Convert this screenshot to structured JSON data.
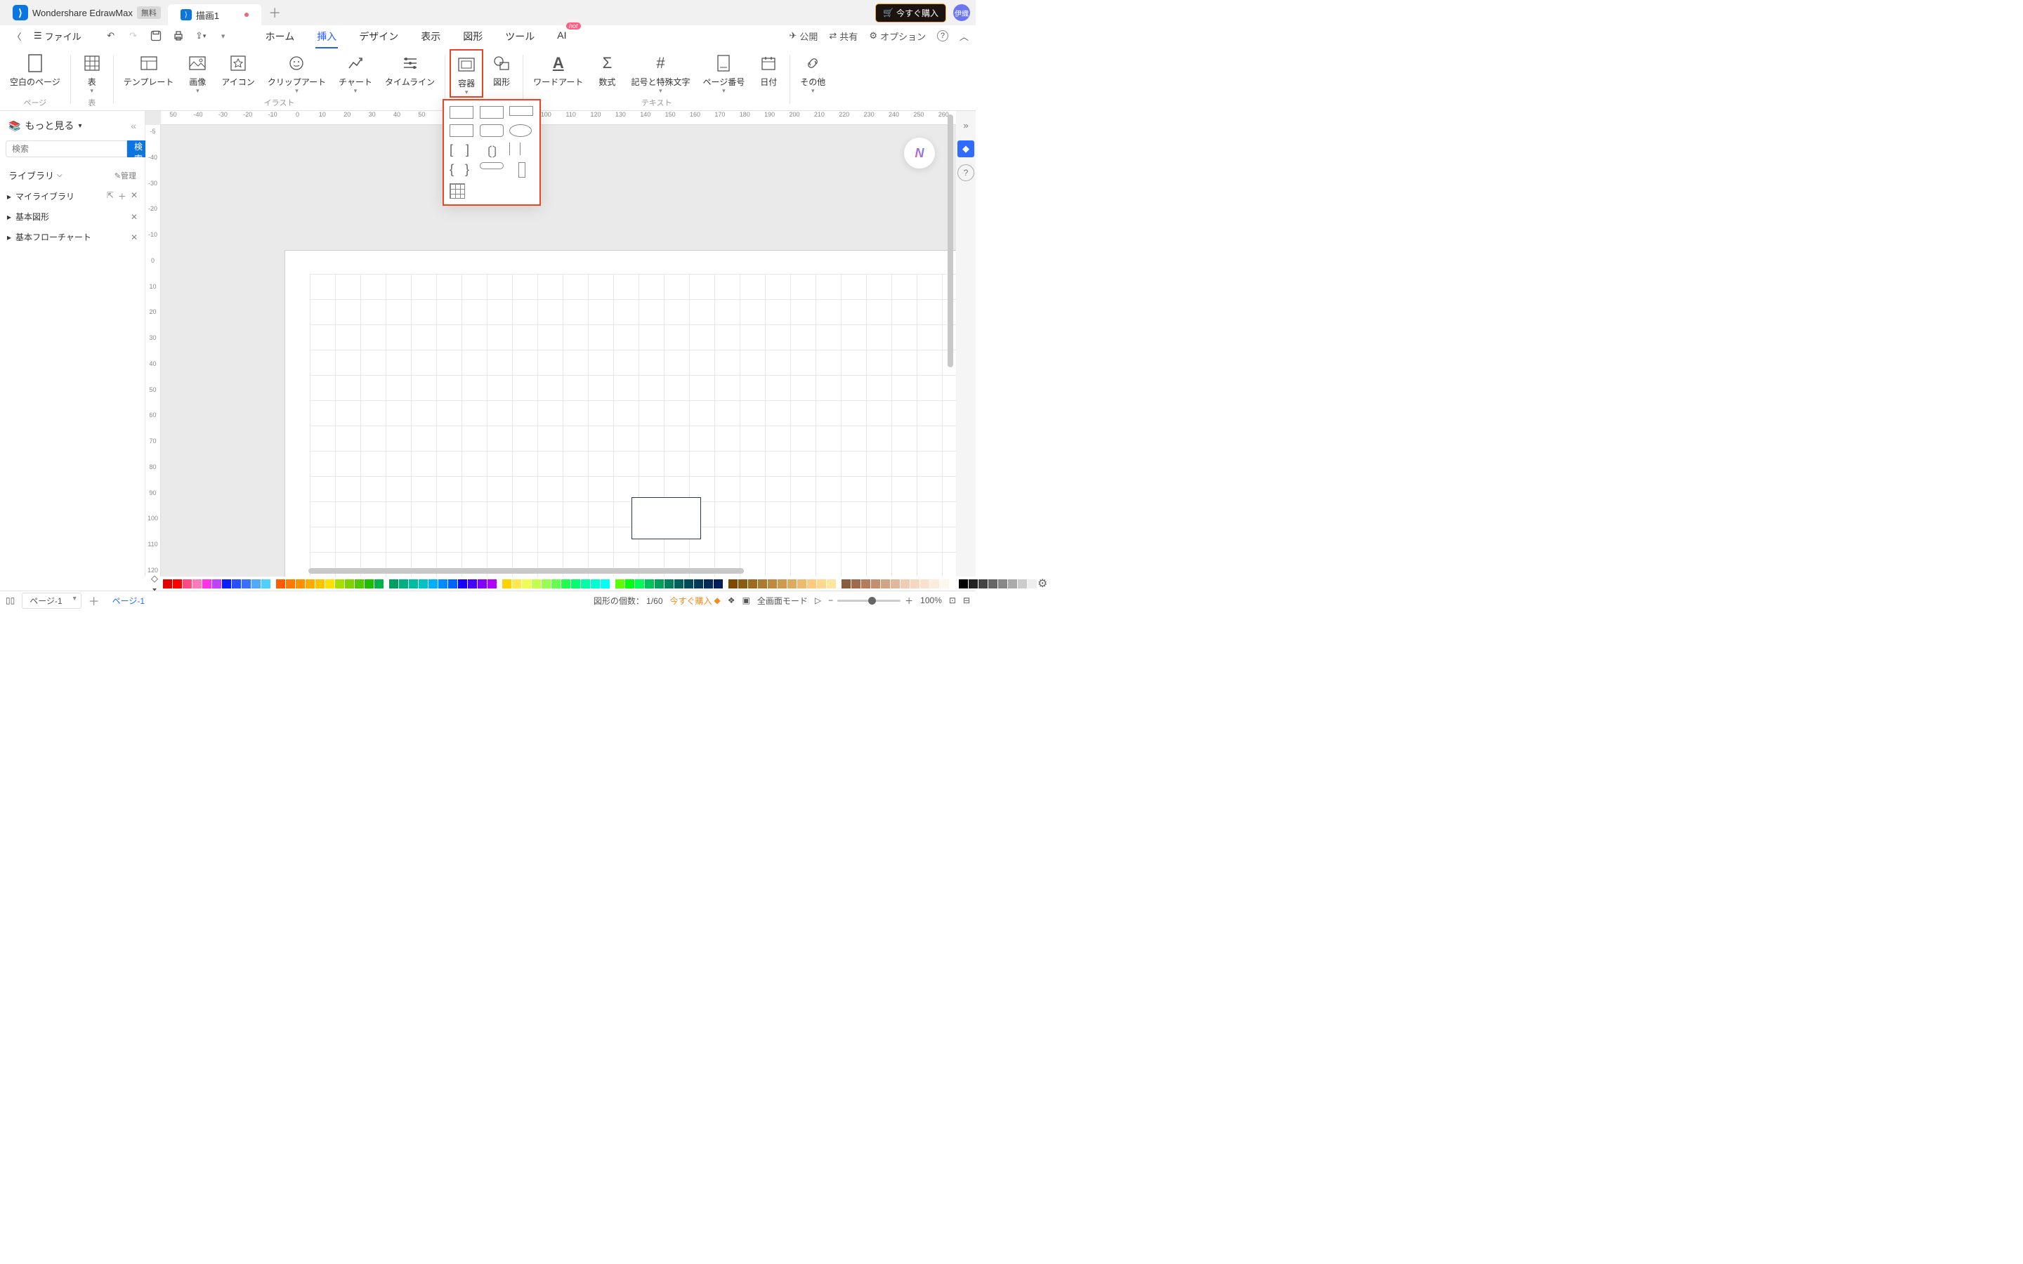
{
  "titlebar": {
    "app_name": "Wondershare EdrawMax",
    "free_badge": "無料",
    "doc_name": "描画1",
    "buy_label": "今すぐ購入",
    "avatar_text": "伊織"
  },
  "toolbar": {
    "file_label": "ファイル",
    "menu": [
      "ホーム",
      "挿入",
      "デザイン",
      "表示",
      "図形",
      "ツール",
      "AI"
    ],
    "active_menu": "挿入",
    "hot_label": "hot",
    "publish": "公開",
    "share": "共有",
    "options": "オプション"
  },
  "ribbon": {
    "groups": [
      {
        "label": "ページ",
        "items": [
          {
            "label": "空白のページ"
          }
        ]
      },
      {
        "label": "表",
        "items": [
          {
            "label": "表"
          }
        ]
      },
      {
        "label": "イラスト",
        "items": [
          {
            "label": "テンプレート"
          },
          {
            "label": "画像"
          },
          {
            "label": "アイコン"
          },
          {
            "label": "クリップアート"
          },
          {
            "label": "チャート"
          },
          {
            "label": "タイムライン"
          }
        ]
      },
      {
        "label": "",
        "items": [
          {
            "label": "容器",
            "highlighted": true
          },
          {
            "label": "図形"
          }
        ]
      },
      {
        "label": "テキスト",
        "items": [
          {
            "label": "ワードアート"
          },
          {
            "label": "数式"
          },
          {
            "label": "記号と特殊文字"
          },
          {
            "label": "ページ番号"
          },
          {
            "label": "日付"
          }
        ]
      },
      {
        "label": "",
        "items": [
          {
            "label": "その他"
          }
        ]
      }
    ]
  },
  "left_panel": {
    "more_label": "もっと見る",
    "search_placeholder": "検索",
    "search_button": "検索",
    "library_label": "ライブラリ",
    "manage_label": "管理",
    "tree": [
      "マイライブラリ",
      "基本図形",
      "基本フローチャート"
    ]
  },
  "ruler_h": [
    "50",
    "-40",
    "-30",
    "-20",
    "-10",
    "0",
    "10",
    "20",
    "30",
    "40",
    "50",
    "60",
    "70",
    "80",
    "90",
    "100",
    "110",
    "120",
    "130",
    "140",
    "150",
    "160",
    "170",
    "180",
    "190",
    "200",
    "210",
    "220",
    "230",
    "240",
    "250",
    "260"
  ],
  "ruler_v": [
    "-5",
    "",
    "-40",
    "",
    "-30",
    "",
    "-20",
    "",
    "-10",
    "",
    "0",
    "",
    "10",
    "",
    "20",
    "",
    "30",
    "",
    "40",
    "",
    "50",
    "",
    "60",
    "",
    "70",
    "",
    "80",
    "",
    "90",
    "",
    "100",
    "",
    "110",
    "",
    "120"
  ],
  "status": {
    "page_label": "ページ-1",
    "page_tab": "ページ-1",
    "shape_count_label": "図形の個数：",
    "shape_count": "1/60",
    "buy_now": "今すぐ購入",
    "fullscreen": "全画面モード",
    "zoom": "100%"
  },
  "colors": {
    "row1": [
      "#e40000",
      "#ff0000",
      "#ff4a86",
      "#ff7ab8",
      "#fe33e8",
      "#c042ff",
      "#0a1fff",
      "#2950ff",
      "#3a6fff",
      "#51aaff",
      "#4ed0ff"
    ],
    "row2": [
      "#ff5b00",
      "#ff7a00",
      "#ff9100",
      "#ffab00",
      "#ffc400",
      "#ffe000",
      "#a4e000",
      "#7bd400",
      "#4fc900",
      "#1dbf00",
      "#00b34a"
    ],
    "row3": [
      "#00a060",
      "#00b080",
      "#00bca0",
      "#00c2c2",
      "#00b0ff",
      "#008bff",
      "#0062ff",
      "#1600ff",
      "#4600ff",
      "#7f00ff",
      "#b200ff"
    ],
    "row4": [
      "#ffd200",
      "#ffe850",
      "#edff50",
      "#c4ff50",
      "#96ff50",
      "#64ff50",
      "#1fff50",
      "#00ff6c",
      "#00ffa2",
      "#00ffd0",
      "#00fff4"
    ],
    "row5": [
      "#5bff00",
      "#00ff14",
      "#00ff55",
      "#00c45a",
      "#00a05a",
      "#00805a",
      "#00605a",
      "#004a5a",
      "#003c5a",
      "#002c5a",
      "#001e5a"
    ],
    "row6": [
      "#7f4a00",
      "#8f5a10",
      "#9f6a20",
      "#af7a30",
      "#bf8a40",
      "#cf9a50",
      "#dfaa60",
      "#efba70",
      "#ffca80",
      "#ffd890",
      "#ffe6a0"
    ],
    "row7": [
      "#8c5a3c",
      "#a06b4a",
      "#b47c58",
      "#c3906f",
      "#d2a486",
      "#e1b89d",
      "#f0ccb4",
      "#f5d7c2",
      "#f9e2d0",
      "#fcecde",
      "#fff6ec"
    ],
    "gray": [
      "#000",
      "#222",
      "#444",
      "#666",
      "#888",
      "#aaa",
      "#ccc",
      "#eee"
    ]
  }
}
